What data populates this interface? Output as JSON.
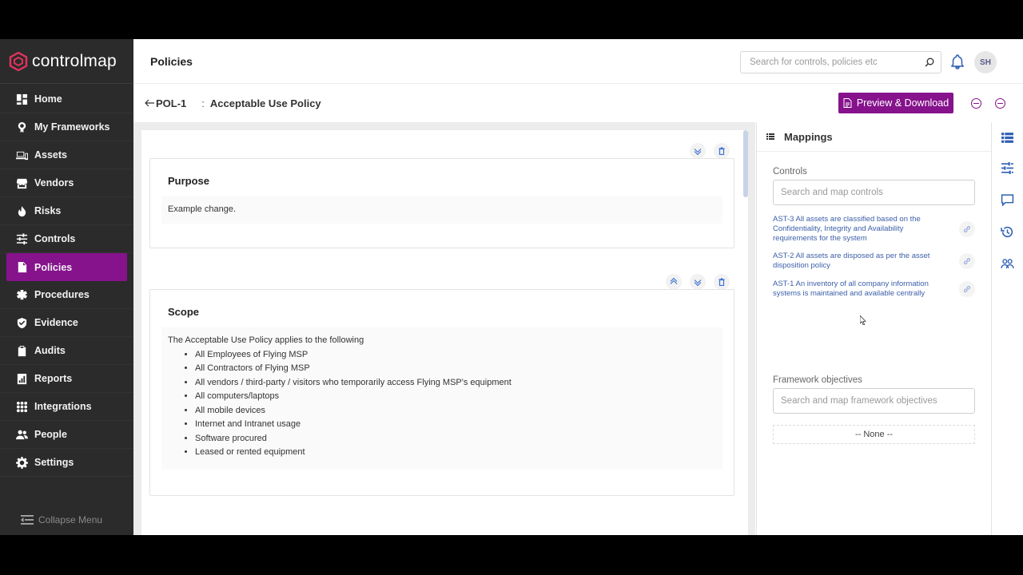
{
  "brand": {
    "name": "controlmap"
  },
  "sidebar": {
    "items": [
      {
        "label": "Home",
        "icon": "dashboard-icon"
      },
      {
        "label": "My Frameworks",
        "icon": "framework-icon"
      },
      {
        "label": "Assets",
        "icon": "assets-icon"
      },
      {
        "label": "Vendors",
        "icon": "vendors-icon"
      },
      {
        "label": "Risks",
        "icon": "risks-icon"
      },
      {
        "label": "Controls",
        "icon": "controls-icon"
      },
      {
        "label": "Policies",
        "icon": "policies-icon",
        "active": true
      },
      {
        "label": "Procedures",
        "icon": "procedures-icon"
      },
      {
        "label": "Evidence",
        "icon": "evidence-icon"
      },
      {
        "label": "Audits",
        "icon": "audits-icon"
      },
      {
        "label": "Reports",
        "icon": "reports-icon"
      },
      {
        "label": "Integrations",
        "icon": "integrations-icon"
      },
      {
        "label": "People",
        "icon": "people-icon"
      },
      {
        "label": "Settings",
        "icon": "settings-icon"
      }
    ],
    "collapse_label": "Collapse Menu"
  },
  "header": {
    "title": "Policies",
    "search_placeholder": "Search for controls, policies etc",
    "avatar_initials": "SH"
  },
  "subheader": {
    "back_label": "POL-1",
    "separator": ":",
    "doc_title": "Acceptable Use Policy",
    "preview_button": "Preview & Download"
  },
  "document": {
    "sections": [
      {
        "title": "Purpose",
        "body": "Example change."
      },
      {
        "title": "Scope",
        "intro": "The Acceptable Use Policy applies to the following",
        "bullets": [
          "All Employees of Flying MSP",
          "All Contractors of Flying MSP",
          "All vendors / third-party / visitors who temporarily access Flying MSP's equipment",
          "All computers/laptops",
          "All mobile devices",
          "Internet and Intranet usage",
          "Software procured",
          "Leased or rented equipment"
        ]
      }
    ]
  },
  "mappings": {
    "title": "Mappings",
    "controls_label": "Controls",
    "controls_placeholder": "Search and map controls",
    "controls": [
      "AST-3 All assets are classified based on the Confidentiality, Integrity and Availability requirements for the system",
      "AST-2 All assets are disposed as per the asset disposition policy",
      "AST-1 An inventory of all company information systems is maintained and available centrally"
    ],
    "objectives_label": "Framework objectives",
    "objectives_placeholder": "Search and map framework objectives",
    "objectives_empty": "-- None --"
  },
  "colors": {
    "accent": "#86128c",
    "sidebar_bg": "#2b2b2b",
    "link": "#3c5fa8"
  }
}
